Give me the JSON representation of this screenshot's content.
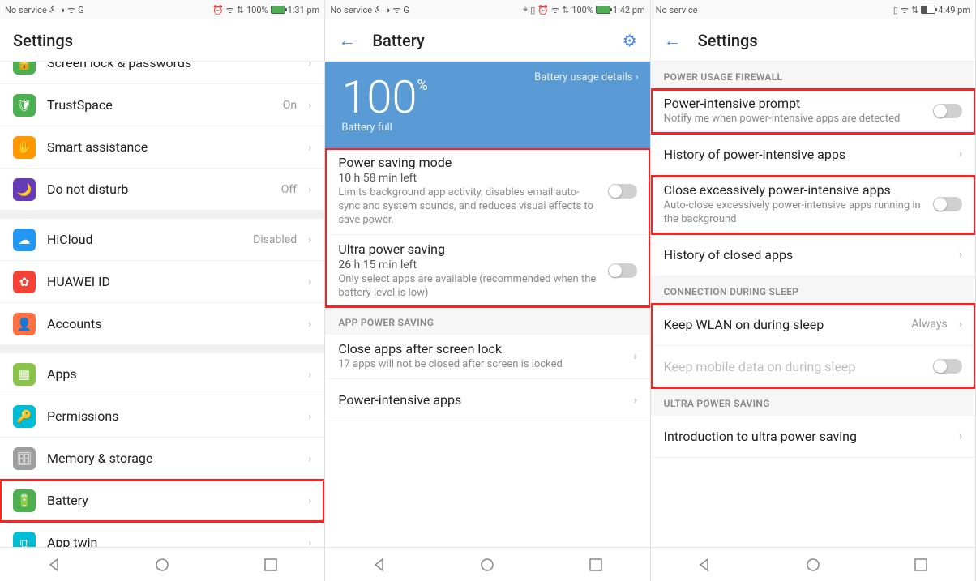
{
  "pane1": {
    "status": {
      "left": "No service",
      "time": "1:31 pm",
      "batt": "100%",
      "extra": [
        "usb",
        "telegram",
        "wifi",
        "g"
      ],
      "alarm": true,
      "data": true
    },
    "title": "Settings",
    "scrollTop": -24,
    "groups": [
      {
        "items": [
          {
            "icon": "lock",
            "color": "ico-green",
            "label": "Screen lock & passwords"
          },
          {
            "icon": "shield",
            "color": "ico-green",
            "label": "TrustSpace",
            "value": "On"
          },
          {
            "icon": "hand",
            "color": "ico-orange",
            "label": "Smart assistance"
          },
          {
            "icon": "moon",
            "color": "ico-purple",
            "label": "Do not disturb",
            "value": "Off"
          }
        ]
      },
      {
        "items": [
          {
            "icon": "cloud",
            "color": "ico-blue",
            "label": "HiCloud",
            "value": "Disabled"
          },
          {
            "icon": "huawei",
            "color": "ico-red",
            "label": "HUAWEI ID"
          },
          {
            "icon": "user",
            "color": "ico-teal",
            "label": "Accounts"
          }
        ]
      },
      {
        "items": [
          {
            "icon": "apps",
            "color": "ico-lime",
            "label": "Apps"
          },
          {
            "icon": "key",
            "color": "ico-cyan",
            "label": "Permissions"
          },
          {
            "icon": "mem",
            "color": "ico-grey",
            "label": "Memory & storage"
          },
          {
            "icon": "batt",
            "color": "ico-green",
            "label": "Battery",
            "hl": true
          },
          {
            "icon": "twin",
            "color": "ico-cyan",
            "label": "App twin"
          }
        ]
      }
    ]
  },
  "pane2": {
    "status": {
      "left": "No service",
      "time": "1:42 pm",
      "batt": "100%",
      "loc": true,
      "vib": true,
      "alarm": true,
      "wifi": true,
      "data": true
    },
    "title": "Battery",
    "back": true,
    "gear": true,
    "battery": {
      "detailsLabel": "Battery usage details",
      "percent": "100",
      "percentSym": "%",
      "fullLabel": "Battery full"
    },
    "modes": [
      {
        "title": "Power saving mode",
        "est": "10 h 58 min left",
        "desc": "Limits background app activity, disables email auto-sync and system sounds, and reduces visual effects to save power."
      },
      {
        "title": "Ultra power saving",
        "est": "26 h 15 min left",
        "desc": "Only select apps are available (recommended when the battery level is low)"
      }
    ],
    "sectionApp": "APP POWER SAVING",
    "closeApps": {
      "title": "Close apps after screen lock",
      "desc": "17 apps will not be closed after screen is locked"
    },
    "peek": "Power-intensive apps"
  },
  "pane3": {
    "status": {
      "left": "No service",
      "time": "4:49 pm",
      "vib": true,
      "wifi": true,
      "data": true,
      "battLow": true
    },
    "title": "Settings",
    "back": true,
    "sections": {
      "firewall": "POWER USAGE FIREWALL",
      "conn": "CONNECTION DURING SLEEP",
      "ultra": "ULTRA POWER SAVING"
    },
    "items": {
      "prompt": {
        "title": "Power-intensive prompt",
        "desc": "Notify me when power-intensive apps are detected"
      },
      "history": {
        "title": "History of power-intensive apps"
      },
      "close": {
        "title": "Close excessively power-intensive apps",
        "desc": "Auto-close excessively power-intensive apps running in the background"
      },
      "historyClosed": {
        "title": "History of closed apps"
      },
      "wlan": {
        "title": "Keep WLAN on during sleep",
        "value": "Always"
      },
      "mobile": {
        "title": "Keep mobile data on during sleep"
      },
      "intro": {
        "title": "Introduction to ultra power saving"
      }
    }
  }
}
